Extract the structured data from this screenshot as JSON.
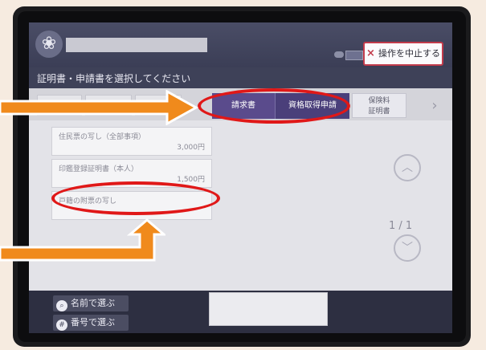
{
  "header": {
    "emblem_glyph": "❀",
    "stop_button_icon": "×",
    "stop_button_label": "操作を中止する"
  },
  "subtitle": "証明書・申請書を選択してください",
  "tabs": [
    {
      "label": "請求書",
      "state": "active"
    },
    {
      "label": "資格取得申請",
      "state": "normal"
    },
    {
      "label": "保険料\n証明書",
      "state": "light"
    }
  ],
  "items": [
    {
      "name": "住民票の写し（全部事項）",
      "price": "3,000円"
    },
    {
      "name": "印鑑登録証明書（本人）",
      "price": "1,500円"
    },
    {
      "name": "戸籍の附票の写し",
      "price": ""
    }
  ],
  "pagination": {
    "page": "1 / 1"
  },
  "side_buttons": [
    {
      "label": "名前で選ぶ",
      "icon": "search-icon"
    },
    {
      "label": "番号で選ぶ",
      "icon": "number-icon"
    }
  ],
  "colors": {
    "annotation_red": "#e01818",
    "annotation_orange": "#f08a1c",
    "tab_active": "#5a4b8c",
    "stop_border": "#c23b4b"
  }
}
